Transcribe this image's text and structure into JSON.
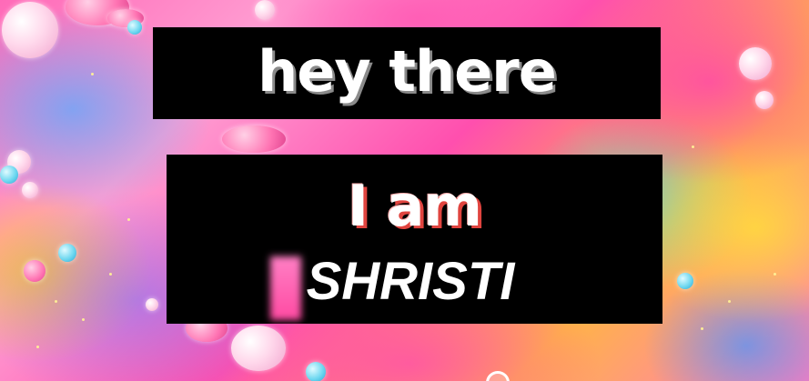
{
  "caption": {
    "line1": "hey there",
    "line2": "I am",
    "name": "SHRISTI"
  },
  "colors": {
    "caption_box": "#000000",
    "text": "#ffffff",
    "line2_shadow": "#e0443f",
    "line1_shadow": "#8a8a8a"
  },
  "background": {
    "style": "colorful paint marbling with bubbles"
  },
  "icons": {
    "bottom_icon": "circle-icon"
  }
}
